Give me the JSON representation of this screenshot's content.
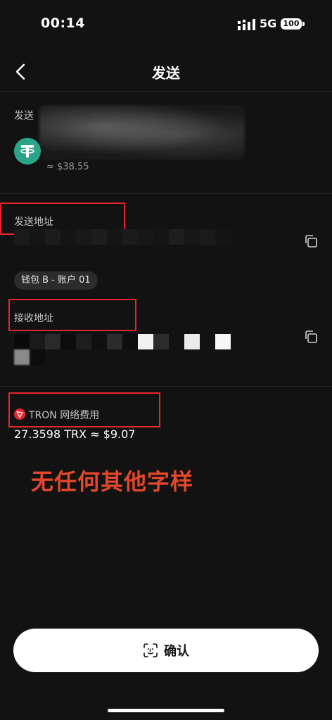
{
  "status_bar": {
    "time": "00:14",
    "network": "5G",
    "battery": "100"
  },
  "header": {
    "title": "发送"
  },
  "send": {
    "label": "发送",
    "amount_usd": "≈ $38.55"
  },
  "from": {
    "label": "发送地址",
    "wallet_tag": "钱包 B - 账户 01"
  },
  "to": {
    "label": "接收地址"
  },
  "fee": {
    "label": "TRON 网络费用",
    "value": "27.3598 TRX ≈ $9.07"
  },
  "overlay_note": "无任何其他字样",
  "confirm": {
    "label": "确认"
  },
  "colors": {
    "background": "#121212",
    "annotation_red": "#e3262e",
    "usdt_green": "#2aa58a",
    "tron_red": "#e3262e"
  },
  "icons": {
    "back": "chevron-left-icon",
    "copy": "copy-icon",
    "faceid": "face-id-icon",
    "token": "tether-icon",
    "chain": "tron-icon"
  }
}
